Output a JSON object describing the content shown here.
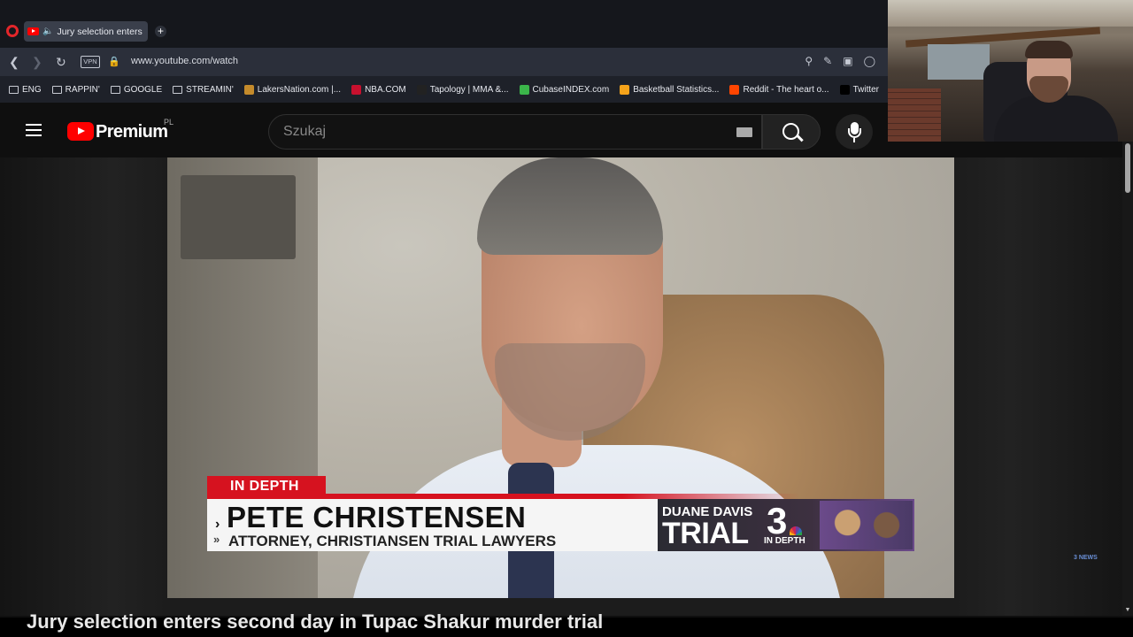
{
  "browser": {
    "tab_title": "Jury selection enters s",
    "new_tab_symbol": "+",
    "url": "www.youtube.com/watch",
    "vpn_label": "VPN",
    "bookmarks": [
      {
        "label": "ENG",
        "type": "folder"
      },
      {
        "label": "RAPPIN'",
        "type": "folder"
      },
      {
        "label": "GOOGLE",
        "type": "folder"
      },
      {
        "label": "STREAMIN'",
        "type": "folder"
      },
      {
        "label": "LakersNation.com |...",
        "type": "site",
        "color": "#c58b2b"
      },
      {
        "label": "NBA.COM",
        "type": "site",
        "color": "#c8102e"
      },
      {
        "label": "Tapology | MMA &...",
        "type": "site",
        "color": "#222222"
      },
      {
        "label": "CubaseINDEX.com",
        "type": "site",
        "color": "#3bb54a"
      },
      {
        "label": "Basketball Statistics...",
        "type": "site",
        "color": "#f5a31a"
      },
      {
        "label": "Reddit - The heart o...",
        "type": "site",
        "color": "#ff4500"
      },
      {
        "label": "Twitter",
        "type": "site",
        "color": "#000000"
      }
    ]
  },
  "youtube": {
    "logo_text": "Premium",
    "region": "PL",
    "search_placeholder": "Szukaj"
  },
  "video": {
    "lower_third": {
      "tag": "IN DEPTH",
      "name": "PETE CHRISTENSEN",
      "title": "ATTORNEY, CHRISTIANSEN TRIAL LAWYERS",
      "promo_line1": "DUANE DAVIS",
      "promo_line2": "TRIAL",
      "promo_channel": "3",
      "promo_sub": "IN DEPTH"
    },
    "watermark": "3 NEWS",
    "title_partial": "Jury selection enters second day in Tupac Shakur murder trial"
  },
  "colors": {
    "accent_red": "#d6121f",
    "youtube_red": "#ff0000",
    "background": "#0f0f0f"
  }
}
